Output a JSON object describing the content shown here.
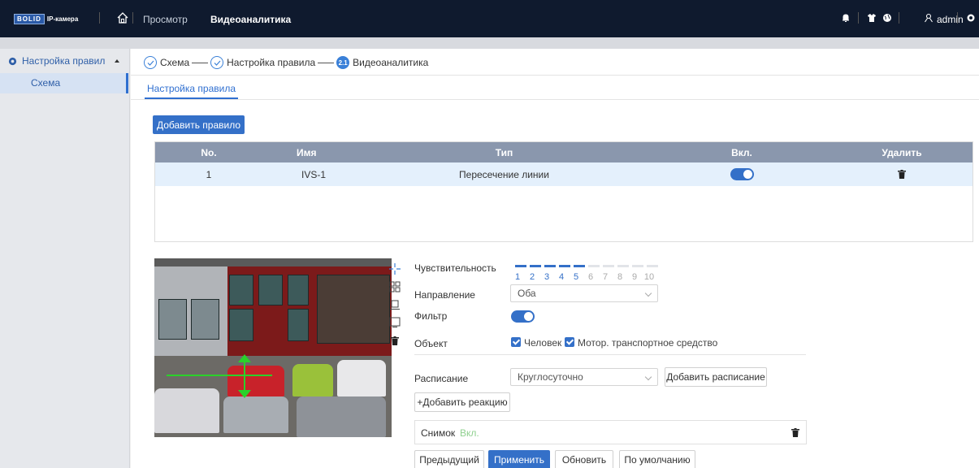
{
  "header": {
    "logo_brand": "BOLID",
    "logo_sub": "IP-камера",
    "nav_view": "Просмотр",
    "nav_videoanalytics": "Видеоаналитика",
    "user": "admin",
    "icons": [
      "home-icon",
      "bell-icon",
      "shirt-icon",
      "globe-icon",
      "user-icon",
      "gear-icon"
    ]
  },
  "sidebar": {
    "section": "Настройка правил",
    "item": "Схема"
  },
  "steps": [
    {
      "label": "Схема",
      "state": "done"
    },
    {
      "label": "Настройка правила",
      "state": "done"
    },
    {
      "label": "Видеоаналитика",
      "state": "active",
      "number": "2.1"
    }
  ],
  "tab": "Настройка правила",
  "add_rule_button": "Добавить правило",
  "table": {
    "headers": {
      "no": "No.",
      "name": "Имя",
      "type": "Тип",
      "enabled": "Вкл.",
      "delete": "Удалить"
    },
    "rows": [
      {
        "no": "1",
        "name": "IVS-1",
        "type": "Пересечение линии",
        "enabled": true
      }
    ]
  },
  "form": {
    "sensitivity_label": "Чувствительность",
    "sensitivity_value": 5,
    "sensitivity_scale": [
      "1",
      "2",
      "3",
      "4",
      "5",
      "6",
      "7",
      "8",
      "9",
      "10"
    ],
    "direction_label": "Направление",
    "direction_value": "Оба",
    "filter_label": "Фильтр",
    "filter_enabled": true,
    "object_label": "Объект",
    "object_person": "Человек",
    "object_vehicle": "Мотор. транспортное средство",
    "schedule_label": "Расписание",
    "schedule_value": "Круглосуточно",
    "add_schedule": "Добавить расписание",
    "add_reaction": "+Добавить реакцию",
    "snapshot_label": "Снимок",
    "snapshot_state": "Вкл."
  },
  "buttons": {
    "previous": "Предыдущий",
    "apply": "Применить",
    "refresh": "Обновить",
    "default": "По умолчанию"
  },
  "colors": {
    "primary": "#3470c8",
    "header_bg": "#0f1a2e",
    "table_header_bg": "#8a97ad",
    "row_selected": "#e4f0fc",
    "line_color": "#2ad12a"
  }
}
